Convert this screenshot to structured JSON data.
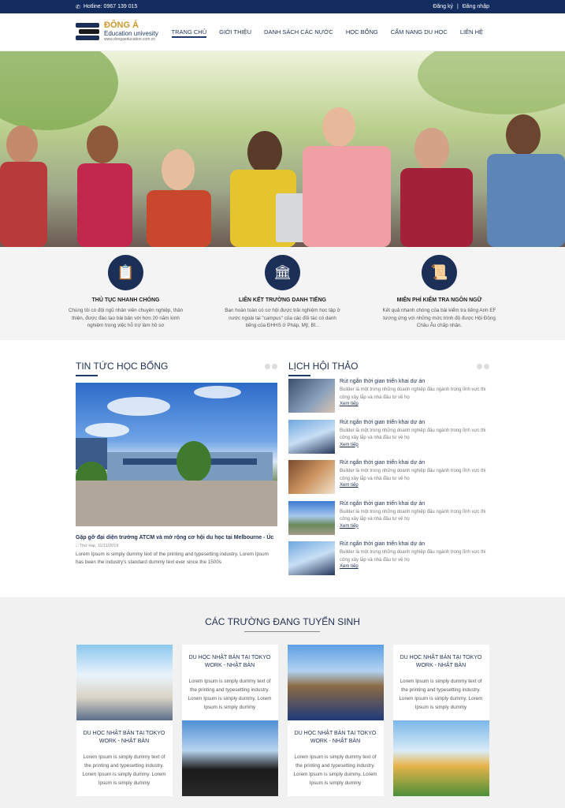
{
  "topbar": {
    "hotline": "Hotline: 0967 139 015",
    "register": "Đăng ký",
    "separator": "|",
    "login": "Đăng nhập"
  },
  "logo": {
    "brand": "ĐÔNG Á",
    "subtitle": "Education univesity",
    "url": "www.dongaeducation.com.vn"
  },
  "nav": [
    "TRANG CHỦ",
    "GIỚI THIỆU",
    "DANH SÁCH CÁC NƯỚC",
    "HỌC BỔNG",
    "CẨM NANG DU HỌC",
    "LIÊN HỆ"
  ],
  "features": [
    {
      "icon": "clipboard-icon",
      "title": "THỦ TỤC NHANH CHÓNG",
      "desc": "Chúng tôi có đội ngũ nhân viên chuyên nghiệp, thân thiện, được đào tạo bài bản với hơn 20 năm kinh nghiệm trong việc hỗ trợ làm hồ sơ"
    },
    {
      "icon": "institution-icon",
      "title": "LIÊN KẾT TRƯỜNG DANH TIẾNG",
      "desc": "Bạn hoàn toàn có cơ hội được trải nghiệm học tập ở nước ngoài tại \"campus\" của các đối tác có danh tiếng của ĐHHS ở Pháp, Mỹ, Bỉ..."
    },
    {
      "icon": "certificate-icon",
      "title": "MIỄN PHÍ KIỂM TRA NGÔN NGỮ",
      "desc": "Kết quả nhanh chóng của bài kiểm tra tiếng Anh EF tương ứng với những mức trình độ được Hội Đồng Châu Âu chấp nhận."
    }
  ],
  "news": {
    "title": "TIN TỨC HỌC BỔNG",
    "headline": "Gặp gỡ đại diện trường ATCM và mở rộng cơ hội du học tại Melbourne - Úc",
    "date": "Thứ Hai, 11/11/2019",
    "desc": "Lorem Ipsum is simply dummy text of the printing and typesetting industry. Lorem Ipsum has been the industry's standard dummy text ever since the 1500s"
  },
  "events": {
    "title": "LỊCH HỘI THẢO",
    "items": [
      {
        "title": "Rút ngắn thời gian triển khai dự án",
        "desc": "Builder là một trong những doanh nghiệp đầu ngành trong lĩnh vực thi công xây lắp và nhà đầu tư về họ",
        "more": "Xem tiếp"
      },
      {
        "title": "Rút ngắn thời gian triển khai dự án",
        "desc": "Builder là một trong những doanh nghiệp đầu ngành trong lĩnh vực thi công xây lắp và nhà đầu tư về họ",
        "more": "Xem tiếp"
      },
      {
        "title": "Rút ngắn thời gian triển khai dự án",
        "desc": "Builder là một trong những doanh nghiệp đầu ngành trong lĩnh vực thi công xây lắp và nhà đầu tư về họ",
        "more": "Xem tiếp"
      },
      {
        "title": "Rút ngắn thời gian triển khai dự án",
        "desc": "Builder là một trong những doanh nghiệp đầu ngành trong lĩnh vực thi công xây lắp và nhà đầu tư về họ",
        "more": "Xem tiếp"
      },
      {
        "title": "Rút ngắn thời gian triển khai dự án",
        "desc": "Builder là một trong những doanh nghiệp đầu ngành trong lĩnh vực thi công xây lắp và nhà đầu tư về họ",
        "more": "Xem tiếp"
      }
    ]
  },
  "schools": {
    "title": "CÁC TRƯỜNG ĐANG TUYỂN SINH",
    "cards": [
      {
        "title": "DU HỌC NHẬT BẢN TẠI TOKYO WORK - NHẬT BẢN",
        "desc": "Lorem Ipsum is simply dummy text of the printing and typesetting industry. Lorem Ipsum is simply dummy. Lorem Ipsum is simply dummy"
      },
      {
        "title": "DU HỌC NHẬT BẢN TẠI TOKYO WORK - NHẬT BẢN",
        "desc": "Lorem Ipsum is simply dummy text of the printing and typesetting industry. Lorem Ipsum is simply dummy. Lorem Ipsum is simply dummy"
      },
      {
        "title": "DU HỌC NHẬT BẢN TẠI TOKYO WORK - NHẬT BẢN",
        "desc": "Lorem Ipsum is simply dummy text of the printing and typesetting industry. Lorem Ipsum is simply dummy. Lorem Ipsum is simply dummy"
      },
      {
        "title": "DU HỌC NHẬT BẢN TẠI TOKYO WORK - NHẬT BẢN",
        "desc": "Lorem Ipsum is simply dummy text of the printing and typesetting industry. Lorem Ipsum is simply dummy. Lorem Ipsum is simply dummy"
      }
    ]
  },
  "colors": {
    "navy": "#132c5f",
    "accent": "#1f3a6a",
    "gold": "#d0962f"
  }
}
